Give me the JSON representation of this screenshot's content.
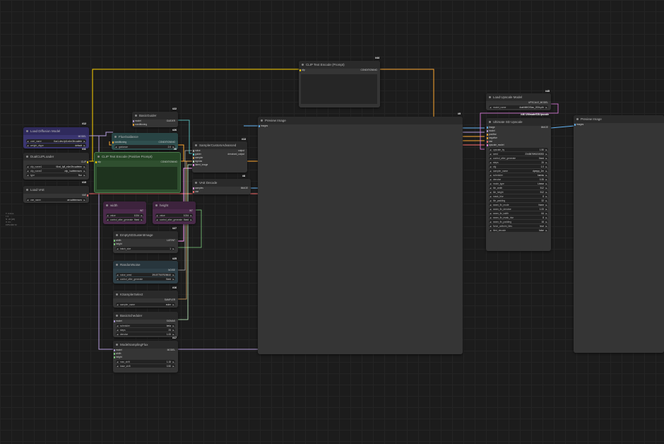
{
  "canvas": {
    "info": [
      "T: 0.0ms",
      "I: 0",
      "N: 22 [22]",
      "V: 21",
      "FPS:196.72"
    ]
  },
  "colors": {
    "model": "#b39ddb",
    "clip": "#ffd500",
    "conditioning": "#ffa931",
    "latent": "#ff9cf9",
    "image": "#64b5f6",
    "vae": "#ff6e6e",
    "noise": "#b0b0b0",
    "sigmas": "#cdffcd",
    "int": "#7fcf7f",
    "upscale": "#ee82ee"
  },
  "nodes": {
    "load_diffusion": {
      "title": "Load Diffusion Model",
      "id": "#12",
      "out": "MODEL",
      "w1_label": "unet_name",
      "w1_value": "flux1-dev-fp8-e4m3fn.safete",
      "w2_label": "weight_dtype",
      "w2_value": "default"
    },
    "dual_clip": {
      "title": "DualCLIPLoader",
      "id": "#11",
      "out": "CLIP",
      "w1_label": "clip_name1",
      "w1_value": "t5xxl_fp8_e4m3fn.safeten",
      "w2_label": "clip_name2",
      "w2_value": "clip_l.safetensors",
      "w3_label": "type",
      "w3_value": "flux"
    },
    "load_vae": {
      "title": "Load VAE",
      "id": "#10",
      "out": "VAE",
      "w1_label": "vae_name",
      "w1_value": "ae.safetensors"
    },
    "flux_guidance": {
      "title": "FluxGuidance",
      "id": "#26",
      "in": "conditioning",
      "out": "CONDITIONING",
      "w1_label": "guidance",
      "w1_value": "2.0"
    },
    "basic_guider": {
      "title": "BasicGuider",
      "id": "#22",
      "in1": "model",
      "in2": "conditioning",
      "out": "GUIDER"
    },
    "clip_text_pos": {
      "title": "CLIP Text Encode (Positive Prompt)",
      "id": "#6",
      "in": "clip",
      "out": "CONDITIONING"
    },
    "clip_text_prompt": {
      "title": "CLIP Text Encode (Prompt)",
      "id": "#44",
      "in": "clip",
      "out": "CONDITIONING"
    },
    "sampler_custom": {
      "title": "SamplerCustomAdvanced",
      "id": "#13",
      "in1": "noise",
      "in2": "guider",
      "in3": "sampler",
      "in4": "sigmas",
      "in5": "latent_image",
      "out1": "output",
      "out2": "denoised_output"
    },
    "vae_decode": {
      "title": "VAE Decode",
      "id": "#8",
      "in1": "samples",
      "in2": "vae",
      "out": "IMAGE"
    },
    "width": {
      "title": "width",
      "id": "#",
      "out": "INT",
      "w1_label": "value",
      "w1_value": "1024",
      "w2_label": "control_after_generate",
      "w2_value": "fixed"
    },
    "height": {
      "title": "height",
      "id": "#",
      "out": "INT",
      "w1_label": "value",
      "w1_value": "1024",
      "w2_label": "control_after_generate",
      "w2_value": "fixed"
    },
    "empty_latent": {
      "title": "EmptySD3LatentImage",
      "id": "#27",
      "in1": "width",
      "in2": "height",
      "out": "LATENT",
      "w1_label": "batch_size",
      "w1_value": "1"
    },
    "random_noise": {
      "title": "RandomNoise",
      "id": "#25",
      "out": "NOISE",
      "w1_label": "noise_seed",
      "w1_value": "391577507928610",
      "w2_label": "control_after_generate",
      "w2_value": "fixed"
    },
    "ksampler_select": {
      "title": "KSamplerSelect",
      "id": "#16",
      "out": "SAMPLER",
      "w1_label": "sampler_name",
      "w1_value": "euler"
    },
    "basic_scheduler": {
      "title": "BasicScheduler",
      "id": "#17",
      "in": "model",
      "out": "SIGMAS",
      "w1_label": "scheduler",
      "w1_value": "beta",
      "w2_label": "steps",
      "w2_value": "25",
      "w3_label": "denoise",
      "w3_value": "1.00"
    },
    "model_sampling": {
      "title": "ModelSamplingFlux",
      "id": "#30",
      "in1": "model",
      "in2": "width",
      "in3": "height",
      "out": "MODEL",
      "w1_label": "max_shift",
      "w1_value": "1.15",
      "w2_label": "base_shift",
      "w2_value": "0.50"
    },
    "preview1": {
      "title": "Preview Image",
      "id": "#9",
      "in": "images"
    },
    "load_upscale": {
      "title": "Load Upscale Model",
      "id": "#45",
      "out": "UPSCALE_MODEL",
      "w1_label": "model_name",
      "w1_value": "4xaNMKDSiax_200k.pth"
    },
    "ultimate": {
      "title": "Ultimate SD Upscale",
      "id": "#46 UltimateSDUpscale",
      "ins": [
        "image",
        "model",
        "positive",
        "negative",
        "vae",
        "upscale_model"
      ],
      "out": "IMAGE",
      "widgets": [
        [
          "upscale_by",
          "1.50"
        ],
        [
          "seed",
          "234587890230053"
        ],
        [
          "control_after_generate",
          "fixed"
        ],
        [
          "steps",
          "20"
        ],
        [
          "cfg",
          "1.0"
        ],
        [
          "sampler_name",
          "dpmpp_2m"
        ],
        [
          "scheduler",
          "karras"
        ],
        [
          "denoise",
          "0.35"
        ],
        [
          "mode_type",
          "Linear"
        ],
        [
          "tile_width",
          "512"
        ],
        [
          "tile_height",
          "512"
        ],
        [
          "mask_blur",
          "8"
        ],
        [
          "tile_padding",
          "32"
        ],
        [
          "seam_fix_mode",
          "None"
        ],
        [
          "seam_fix_denoise",
          "1.00"
        ],
        [
          "seam_fix_width",
          "64"
        ],
        [
          "seam_fix_mask_blur",
          "8"
        ],
        [
          "seam_fix_padding",
          "16"
        ],
        [
          "force_uniform_tiles",
          "true"
        ],
        [
          "tiled_decode",
          "false"
        ]
      ]
    },
    "preview2": {
      "title": "Preview Image",
      "in": "images"
    }
  }
}
